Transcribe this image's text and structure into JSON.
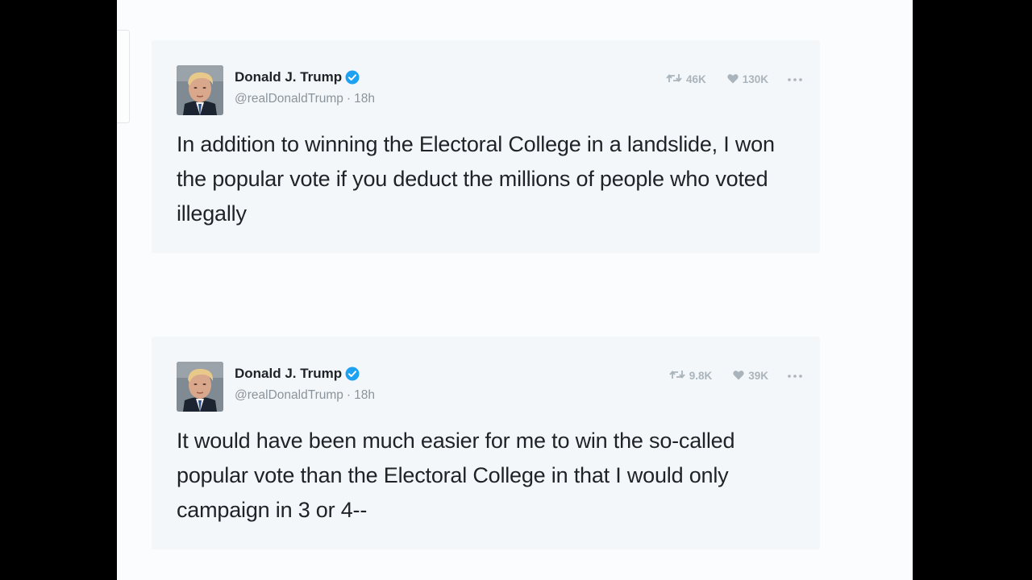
{
  "tweets": [
    {
      "author_name": "Donald J. Trump",
      "handle": "@realDonaldTrump",
      "separator": "·",
      "time": "18h",
      "retweets": "46K",
      "likes": "130K",
      "text": "In addition to winning the Electoral College in a landslide, I won the popular vote if you deduct the millions of people who voted illegally"
    },
    {
      "author_name": "Donald J. Trump",
      "handle": "@realDonaldTrump",
      "separator": "·",
      "time": "18h",
      "retweets": "9.8K",
      "likes": "39K",
      "text": "It would have been much easier for me to win the so-called popular vote than the Electoral College in that I would only campaign in 3 or 4--"
    }
  ],
  "icons": {
    "verified": "verified-badge-icon",
    "retweet": "retweet-icon",
    "like": "heart-icon",
    "more": "more-dots-icon"
  },
  "colors": {
    "verified_blue": "#1da1f2",
    "card_background": "#f4f7f9",
    "text": "#1f2327",
    "muted": "#8a949c"
  }
}
